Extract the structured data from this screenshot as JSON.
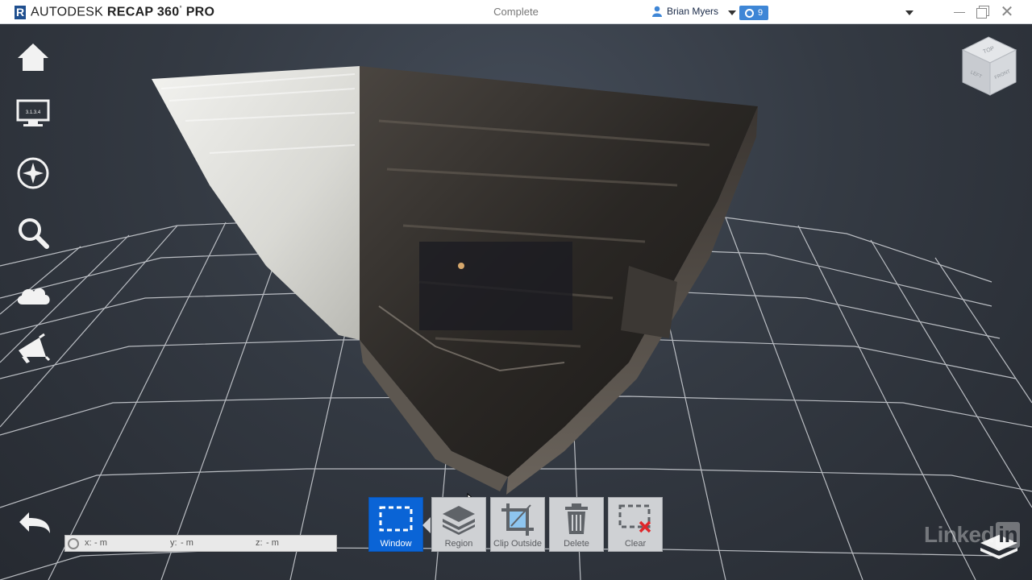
{
  "titlebar": {
    "app_brand": "AUTODESK",
    "app_product": "RECAP 360",
    "app_edition": "PRO",
    "status": "Complete",
    "user_name": "Brian Myers",
    "notification_count": "9"
  },
  "left_tools": [
    {
      "name": "home",
      "icon": "home-icon"
    },
    {
      "name": "display",
      "icon": "monitor-icon",
      "badge": "3.1.3.4"
    },
    {
      "name": "navigate",
      "icon": "compass-icon"
    },
    {
      "name": "search",
      "icon": "magnifier-icon"
    },
    {
      "name": "cloud",
      "icon": "cloud-icon"
    },
    {
      "name": "announce",
      "icon": "megaphone-icon"
    }
  ],
  "viewcube": {
    "top": "TOP",
    "left": "LEFT",
    "front": "FRONT"
  },
  "coords": {
    "x_label": "x:",
    "x_val": "- m",
    "y_label": "y:",
    "y_val": "- m",
    "z_label": "z:",
    "z_val": "- m"
  },
  "toolbar": {
    "window_label": "Window",
    "region_label": "Region",
    "clip_outside_label": "Clip Outside",
    "delete_label": "Delete",
    "clear_label": "Clear"
  },
  "watermark": {
    "text": "Linked",
    "badge": "in"
  },
  "colors": {
    "accent": "#0a64d6",
    "background": "#2a2e35",
    "grid": "#c9ccd1"
  }
}
